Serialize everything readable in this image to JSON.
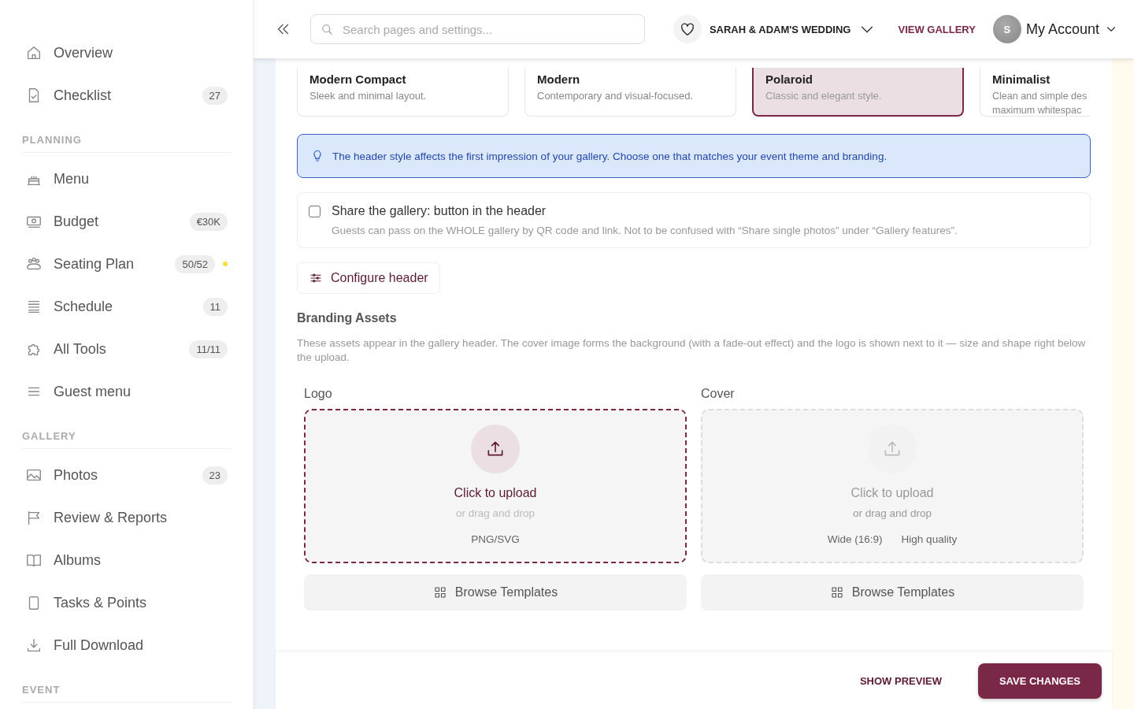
{
  "sidebar": {
    "top_items": [
      {
        "label": "Overview"
      },
      {
        "label": "Checklist",
        "badge": "27"
      }
    ],
    "sections": [
      {
        "title": "PLANNING",
        "items": [
          {
            "label": "Menu"
          },
          {
            "label": "Budget",
            "badge": "€30K"
          },
          {
            "label": "Seating Plan",
            "badge": "50/52",
            "color": "#f7e13b"
          },
          {
            "label": "Schedule",
            "badge": "11"
          },
          {
            "label": "All Tools",
            "badge": "11/11"
          },
          {
            "label": "Guest menu"
          }
        ]
      },
      {
        "title": "GALLERY",
        "items": [
          {
            "label": "Photos",
            "badge": "23"
          },
          {
            "label": "Review & Reports"
          },
          {
            "label": "Albums"
          },
          {
            "label": "Tasks & Points"
          },
          {
            "label": "Full Download"
          }
        ]
      },
      {
        "title": "EVENT"
      }
    ]
  },
  "topbar": {
    "search": {
      "placeholder": "Search pages and settings..."
    },
    "event": "SARAH & ADAM'S WEDDING",
    "view_gallery": "VIEW GALLERY",
    "avatar": "S",
    "account": "My Account"
  },
  "style_cards": [
    {
      "title": "Modern Compact",
      "description_lines": [
        "Sleek and minimal layout."
      ],
      "selected": false
    },
    {
      "title": "Modern",
      "description_lines": [
        "Contemporary and visual-focused."
      ],
      "selected": false
    },
    {
      "title": "Polaroid",
      "description_lines": [
        "Classic and elegant style."
      ],
      "selected": true
    },
    {
      "title": "Minimalist",
      "description_lines": [
        "Clean and simple des",
        "maximum whitespac"
      ],
      "selected": false
    }
  ],
  "info": "The header style affects the first impression of your gallery. Choose one that matches your event theme and branding.",
  "share_option": {
    "title": "Share the gallery: button in the header",
    "description": "Guests can pass on the WHOLE gallery by QR code and link. Not to be confused with “Share single photos” under “Gallery features”.",
    "checked": false
  },
  "configure_button": "Configure header",
  "branding": {
    "title": "Branding Assets",
    "description": "These assets appear in the gallery header. The cover image forms the background (with a fade-out effect) and the logo is shown next to it — size and shape right below the upload."
  },
  "uploads": [
    {
      "label": "Logo",
      "action": "Click to upload",
      "subtext": "or drag and drop",
      "hints": [
        "PNG/SVG"
      ],
      "disabled": false,
      "browse": "Browse Templates"
    },
    {
      "label": "Cover",
      "action": "Click to upload",
      "subtext": "or drag and drop",
      "hints": [
        "Wide (16:9)",
        "High quality"
      ],
      "disabled": true,
      "browse": "Browse Templates"
    }
  ],
  "footer": {
    "preview": "SHOW PREVIEW",
    "save": "SAVE CHANGES"
  }
}
